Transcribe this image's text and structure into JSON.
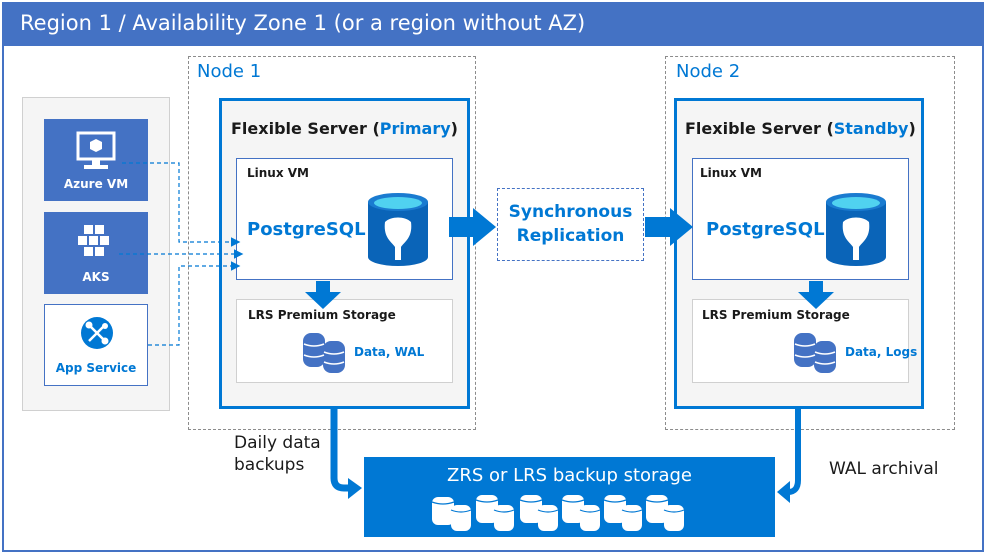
{
  "region": {
    "title": "Region 1 / Availability Zone 1 (or a region without AZ)"
  },
  "clients": [
    {
      "label": "Azure VM",
      "icon": "monitor-icon"
    },
    {
      "label": "AKS",
      "icon": "kubernetes-cluster-icon"
    },
    {
      "label": "App Service",
      "icon": "app-service-icon"
    }
  ],
  "node1": {
    "label": "Node 1",
    "server_prefix": "Flexible Server (",
    "server_role": "Primary",
    "server_suffix": ")",
    "vm_label": "Linux VM",
    "db_label": "PostgreSQL",
    "storage_label": "LRS Premium Storage",
    "storage_data": "Data, WAL"
  },
  "node2": {
    "label": "Node 2",
    "server_prefix": "Flexible Server (",
    "server_role": "Standby",
    "server_suffix": ")",
    "vm_label": "Linux VM",
    "db_label": "PostgreSQL",
    "storage_label": "LRS Premium Storage",
    "storage_data": "Data, Logs"
  },
  "replication": {
    "line1": "Synchronous",
    "line2": "Replication"
  },
  "backup": {
    "label": "ZRS or LRS backup storage",
    "left_caption_line1": "Daily data",
    "left_caption_line2": "backups",
    "right_caption": "WAL archival"
  },
  "colors": {
    "accent": "#0078d4",
    "header": "#4472c4",
    "panel": "#f5f5f5"
  }
}
